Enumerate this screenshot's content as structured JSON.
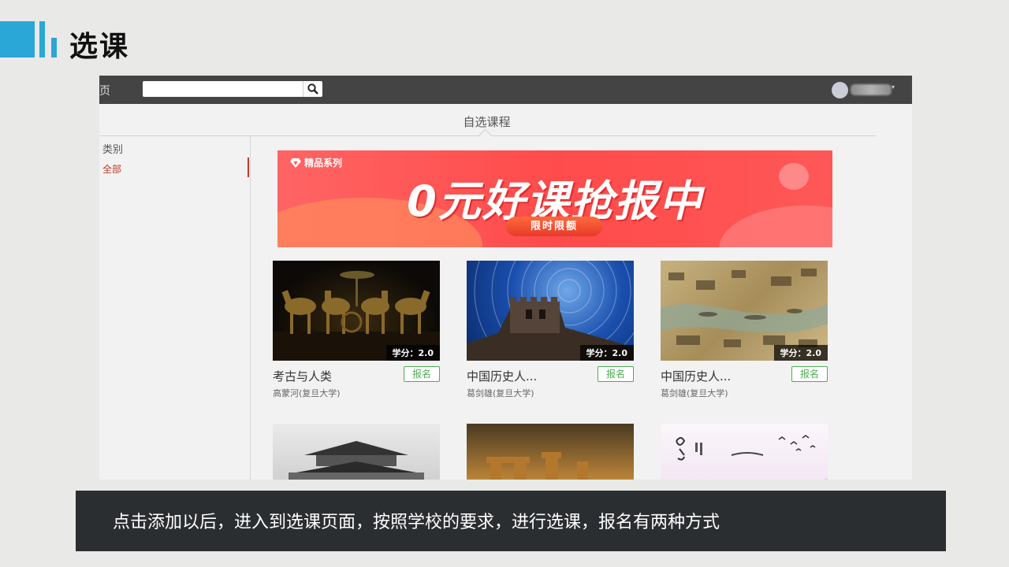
{
  "slide": {
    "title": "选课",
    "caption": "点击添加以后，进入到选课页面，按照学校的要求，进行选课，报名有两种方式",
    "accent_color": "#2aa7d6"
  },
  "app": {
    "nav_home": "页",
    "search": {
      "value": "",
      "placeholder": "",
      "icon": "search-icon"
    },
    "user": {
      "avatar_icon": "avatar-icon",
      "caret": "▾"
    },
    "page_heading": "自选课程",
    "sidebar": {
      "heading": "类别",
      "items": [
        {
          "label": "全部",
          "active": true
        }
      ]
    },
    "banner": {
      "tag": "精品系列",
      "headline": "0元好课抢报中",
      "pill": "限时限额",
      "tag_icon": "diamond-icon"
    },
    "courses": [
      {
        "title": "考古与人类",
        "teacher": "高蒙河(复旦大学)",
        "credit": "学分：2.0",
        "action": "报名"
      },
      {
        "title": "中国历史人...",
        "teacher": "葛剑雄(复旦大学)",
        "credit": "学分：2.0",
        "action": "报名"
      },
      {
        "title": "中国历史人...",
        "teacher": "葛剑雄(复旦大学)",
        "credit": "学分：2.0",
        "action": "报名"
      }
    ],
    "colors": {
      "topbar": "#444444",
      "signup_green": "#4caf50",
      "active_red": "#c0392b",
      "banner_red": "#ff4b4b"
    }
  }
}
